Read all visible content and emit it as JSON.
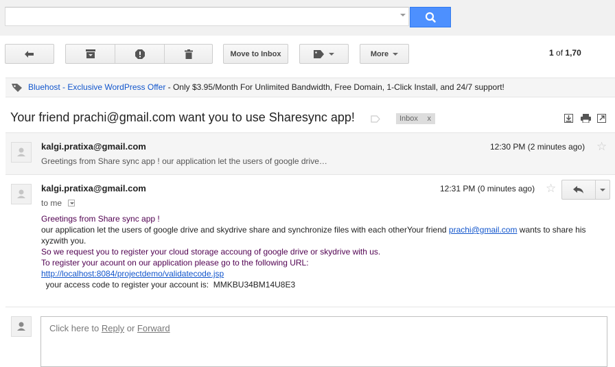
{
  "search": {
    "value": "",
    "placeholder": ""
  },
  "toolbar": {
    "back_icon": "arrow-left-icon",
    "archive_icon": "archive-icon",
    "spam_icon": "report-spam-icon",
    "delete_icon": "trash-icon",
    "move_to_inbox_label": "Move to Inbox",
    "labels_icon": "label-tag-icon",
    "more_label": "More"
  },
  "pagination": {
    "current": "1",
    "of": "of",
    "total": "1,70"
  },
  "ad": {
    "sponsor": "Bluehost",
    "separator": " - ",
    "title": "Exclusive WordPress Offer",
    "text": " - Only $3.95/Month For Unlimited Bandwidth, Free Domain, 1-Click Install, and 24/7 support!"
  },
  "subject": "Your friend prachi@gmail.com want you to use Sharesync app!",
  "label": {
    "name": "Inbox",
    "remove": "x"
  },
  "messages": [
    {
      "sender": "kalgi.pratixa@gmail.com",
      "snippet": "Greetings from Share sync app ! our application let the users of google drive…",
      "time": "12:30 PM (2 minutes ago)"
    },
    {
      "sender": "kalgi.pratixa@gmail.com",
      "recipient": "to me",
      "time": "12:31 PM (0 minutes ago)",
      "body": {
        "line1": "Greetings from Share sync app !",
        "line2a": "our application let the users of google drive and skydrive share and synchronize files with each otherYour friend ",
        "line2_link": "prachi@gmail.com",
        "line2b": " wants to share his xyzwith you.",
        "line3": "So we request you to register your cloud storage accoung of google drive or skydrive with us.",
        "line4": "To register your acount on our application please go to the following URL:",
        "url": "http://localhost:8084/projectdemo/validatecode.jsp",
        "line6": "  your access code to register your account is:  MMKBU34BM14U8E3"
      }
    }
  ],
  "reply": {
    "prefix": "Click here to ",
    "reply": "Reply",
    "or": " or ",
    "forward": "Forward"
  },
  "colors": {
    "accent": "#4d90fe",
    "link": "#1155cc",
    "body_text": "#500050"
  }
}
